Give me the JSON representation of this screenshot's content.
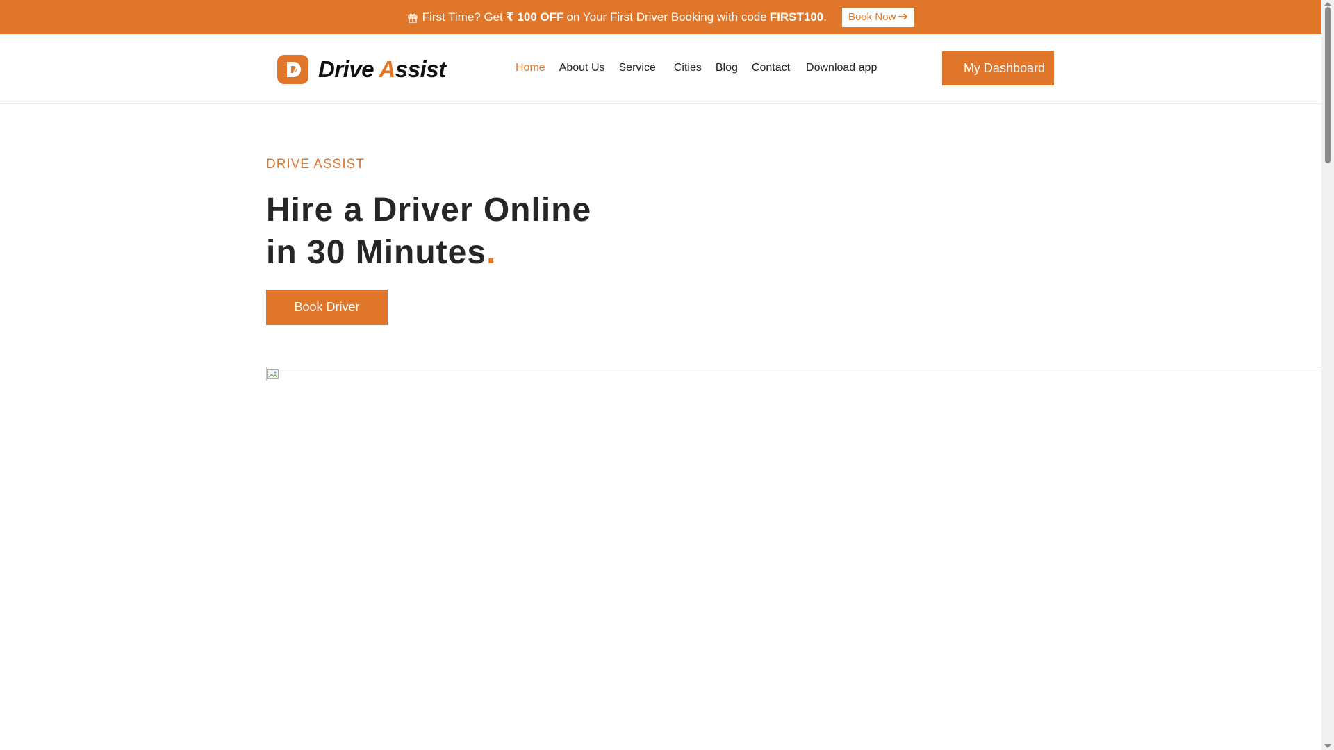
{
  "promo": {
    "text_prefix": "First Time? Get",
    "currency_symbol": "₹",
    "discount": "100 OFF",
    "text_middle": "on Your First Driver Booking with code",
    "code": "FIRST100",
    "text_suffix": ".",
    "button_label": "Book Now",
    "button_icon": "arrow-right-icon",
    "icon": "gift-icon"
  },
  "header": {
    "logo_text_part1": "Drive ",
    "logo_text_accent": "A",
    "logo_text_part2": "ssist",
    "nav": [
      {
        "label": "Home",
        "active": true
      },
      {
        "label": "About Us",
        "active": false
      },
      {
        "label": "Service",
        "active": false
      },
      {
        "label": "Cities",
        "active": false
      },
      {
        "label": "Blog",
        "active": false
      },
      {
        "label": "Contact",
        "active": false
      },
      {
        "label": "Download app",
        "active": false
      }
    ],
    "dashboard_label": "My Dashboard"
  },
  "hero": {
    "eyebrow": "DRIVE ASSIST",
    "headline_line1": "Hire a Driver Online",
    "headline_line2": "in 30 Minutes",
    "headline_dot": ".",
    "cta_label": "Book Driver"
  },
  "colors": {
    "accent": "#E0762A",
    "text": "#262626",
    "background": "#ffffff"
  }
}
